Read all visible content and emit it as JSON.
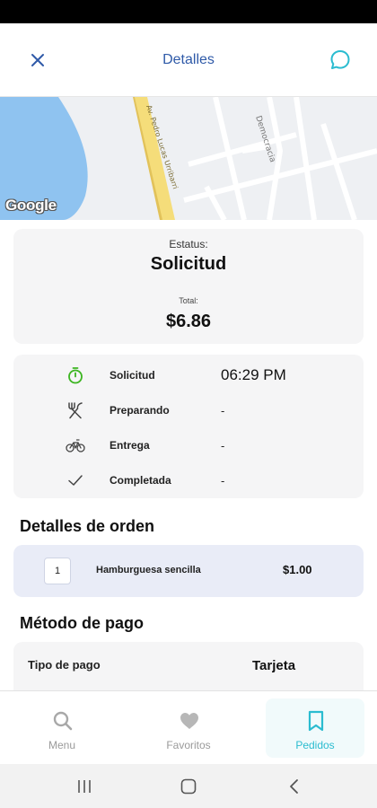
{
  "header": {
    "title": "Detalles",
    "close_icon": "close-icon",
    "chat_icon": "chat-bubble-icon",
    "accent_color": "#2f5aa8",
    "chat_color": "#2bbcd0"
  },
  "map": {
    "logo_text": "Google",
    "street_labels": [
      "Av. Pedro Lucas Urribarri",
      "Democracia"
    ]
  },
  "status": {
    "label": "Estatus:",
    "value": "Solicitud",
    "total_label": "Total:",
    "total_value": "$6.86"
  },
  "timeline": [
    {
      "label": "Solicitud",
      "value": "06:29 PM",
      "icon": "stopwatch-icon",
      "active": true
    },
    {
      "label": "Preparando",
      "value": "-",
      "icon": "fork-knife-icon",
      "active": false
    },
    {
      "label": "Entrega",
      "value": "-",
      "icon": "bicycle-icon",
      "active": false
    },
    {
      "label": "Completada",
      "value": "-",
      "icon": "checkmark-icon",
      "active": false
    }
  ],
  "order_details": {
    "title": "Detalles de orden",
    "items": [
      {
        "qty": "1",
        "name": "Hamburguesa sencilla",
        "price": "$1.00"
      }
    ]
  },
  "payment": {
    "title": "Método de pago",
    "type_label": "Tipo de pago",
    "type_value": "Tarjeta"
  },
  "tabs": [
    {
      "label": "Menu",
      "icon": "search-icon",
      "active": false
    },
    {
      "label": "Favoritos",
      "icon": "heart-icon",
      "active": false
    },
    {
      "label": "Pedidos",
      "icon": "bookmark-icon",
      "active": true
    }
  ],
  "colors": {
    "active_tab": "#2bbcd0",
    "inactive_tab": "#9a9a9a",
    "stopwatch": "#3cb521",
    "order_card_bg": "#e9ecf7"
  }
}
